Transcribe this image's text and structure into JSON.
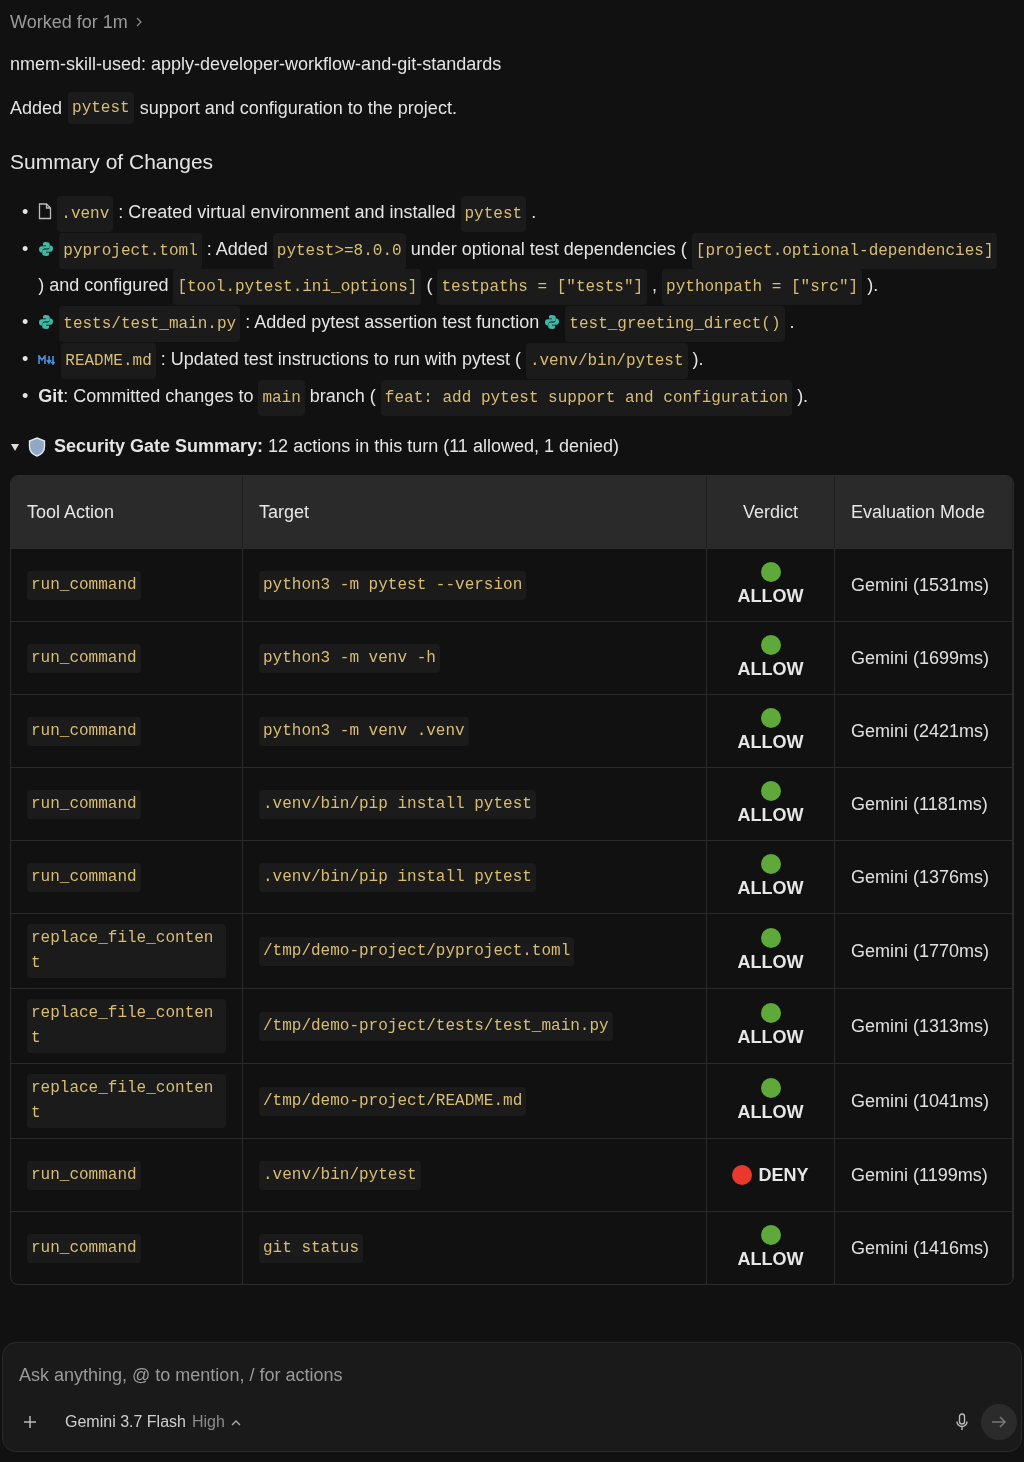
{
  "header": {
    "worked": "Worked for 1m"
  },
  "skill_line": "nmem-skill-used: apply-developer-workflow-and-git-standards",
  "intro": [
    {
      "kind": "text",
      "text": "Added"
    },
    {
      "kind": "code",
      "text": "pytest"
    },
    {
      "kind": "text",
      "text": "support and configuration to the project."
    }
  ],
  "summary_title": "Summary of Changes",
  "bullets": [
    {
      "marker": "•",
      "segments": [
        {
          "kind": "file"
        },
        {
          "kind": "code",
          "text": ".venv"
        },
        {
          "kind": "text",
          "text": ": Created virtual environment and installed"
        },
        {
          "kind": "code",
          "text": "pytest"
        },
        {
          "kind": "text",
          "text": "."
        }
      ]
    },
    {
      "marker": "•",
      "segments": [
        {
          "kind": "python"
        },
        {
          "kind": "code",
          "text": "pyproject.toml"
        },
        {
          "kind": "text",
          "text": ": Added"
        },
        {
          "kind": "code",
          "text": "pytest>=8.0.0"
        },
        {
          "kind": "text",
          "text": "under optional test dependencies ("
        },
        {
          "kind": "code",
          "text": "[project.optional-dependencies]"
        },
        {
          "kind": "text",
          "text": ") and configured"
        },
        {
          "kind": "code",
          "text": "[tool.pytest.ini_options]"
        },
        {
          "kind": "text",
          "text": "("
        },
        {
          "kind": "code",
          "text": "testpaths = [\"tests\"]"
        },
        {
          "kind": "text",
          "text": ","
        },
        {
          "kind": "code",
          "text": "pythonpath = [\"src\"]"
        },
        {
          "kind": "text",
          "text": ")."
        }
      ]
    },
    {
      "marker": "•",
      "segments": [
        {
          "kind": "python"
        },
        {
          "kind": "code",
          "text": "tests/test_main.py"
        },
        {
          "kind": "text",
          "text": ": Added pytest assertion test function"
        },
        {
          "kind": "python"
        },
        {
          "kind": "code",
          "text": "test_greeting_direct()"
        },
        {
          "kind": "text",
          "text": "."
        }
      ]
    },
    {
      "marker": "•",
      "segments": [
        {
          "kind": "markdown"
        },
        {
          "kind": "code",
          "text": "README.md"
        },
        {
          "kind": "text",
          "text": ": Updated test instructions to run with pytest ("
        },
        {
          "kind": "code",
          "text": ".venv/bin/pytest"
        },
        {
          "kind": "text",
          "text": ")."
        }
      ]
    },
    {
      "marker": "•",
      "segments": [
        {
          "kind": "text",
          "text": "**Git**: Committed changes to"
        },
        {
          "kind": "code",
          "text": "main"
        },
        {
          "kind": "text",
          "text": "branch ("
        },
        {
          "kind": "code",
          "text": "feat: add pytest support and configuration"
        },
        {
          "kind": "text",
          "text": ")."
        }
      ]
    }
  ],
  "security": {
    "expanded": true,
    "title": "Security Gate Summary:",
    "text": "12 actions in this turn (11 allowed, 1 denied)"
  },
  "table": {
    "columns": [
      "Tool Action",
      "Target",
      "Verdict",
      "Evaluation Mode"
    ],
    "rows": [
      {
        "action": "run_command",
        "target": "python3 -m pytest --version",
        "verdict": "ALLOW",
        "color": "#5fa83a",
        "mode": "Gemini (1531ms)"
      },
      {
        "action": "run_command",
        "target": "python3 -m venv -h",
        "verdict": "ALLOW",
        "color": "#5fa83a",
        "mode": "Gemini (1699ms)"
      },
      {
        "action": "run_command",
        "target": "python3 -m venv .venv",
        "verdict": "ALLOW",
        "color": "#5fa83a",
        "mode": "Gemini (2421ms)"
      },
      {
        "action": "run_command",
        "target": ".venv/bin/pip install pytest",
        "verdict": "ALLOW",
        "color": "#5fa83a",
        "mode": "Gemini (1181ms)"
      },
      {
        "action": "run_command",
        "target": ".venv/bin/pip install pytest",
        "verdict": "ALLOW",
        "color": "#5fa83a",
        "mode": "Gemini (1376ms)"
      },
      {
        "action": "replace_file_content",
        "target": "/tmp/demo-project/pyproject.toml",
        "verdict": "ALLOW",
        "color": "#5fa83a",
        "mode": "Gemini (1770ms)"
      },
      {
        "action": "replace_file_content",
        "target": "/tmp/demo-project/tests/test_main.py",
        "verdict": "ALLOW",
        "color": "#5fa83a",
        "mode": "Gemini (1313ms)"
      },
      {
        "action": "replace_file_content",
        "target": "/tmp/demo-project/README.md",
        "verdict": "ALLOW",
        "color": "#5fa83a",
        "mode": "Gemini (1041ms)"
      },
      {
        "action": "run_command",
        "target": ".venv/bin/pytest",
        "verdict": "DENY",
        "color": "#e8392f",
        "mode": "Gemini (1199ms)"
      },
      {
        "action": "run_command",
        "target": "git status",
        "verdict": "ALLOW",
        "color": "#5fa83a",
        "mode": "Gemini (1416ms)"
      }
    ]
  },
  "composer": {
    "placeholder": "Ask anything, @ to mention, / for actions",
    "model": "Gemini 3.7 Flash",
    "effort": "High"
  }
}
